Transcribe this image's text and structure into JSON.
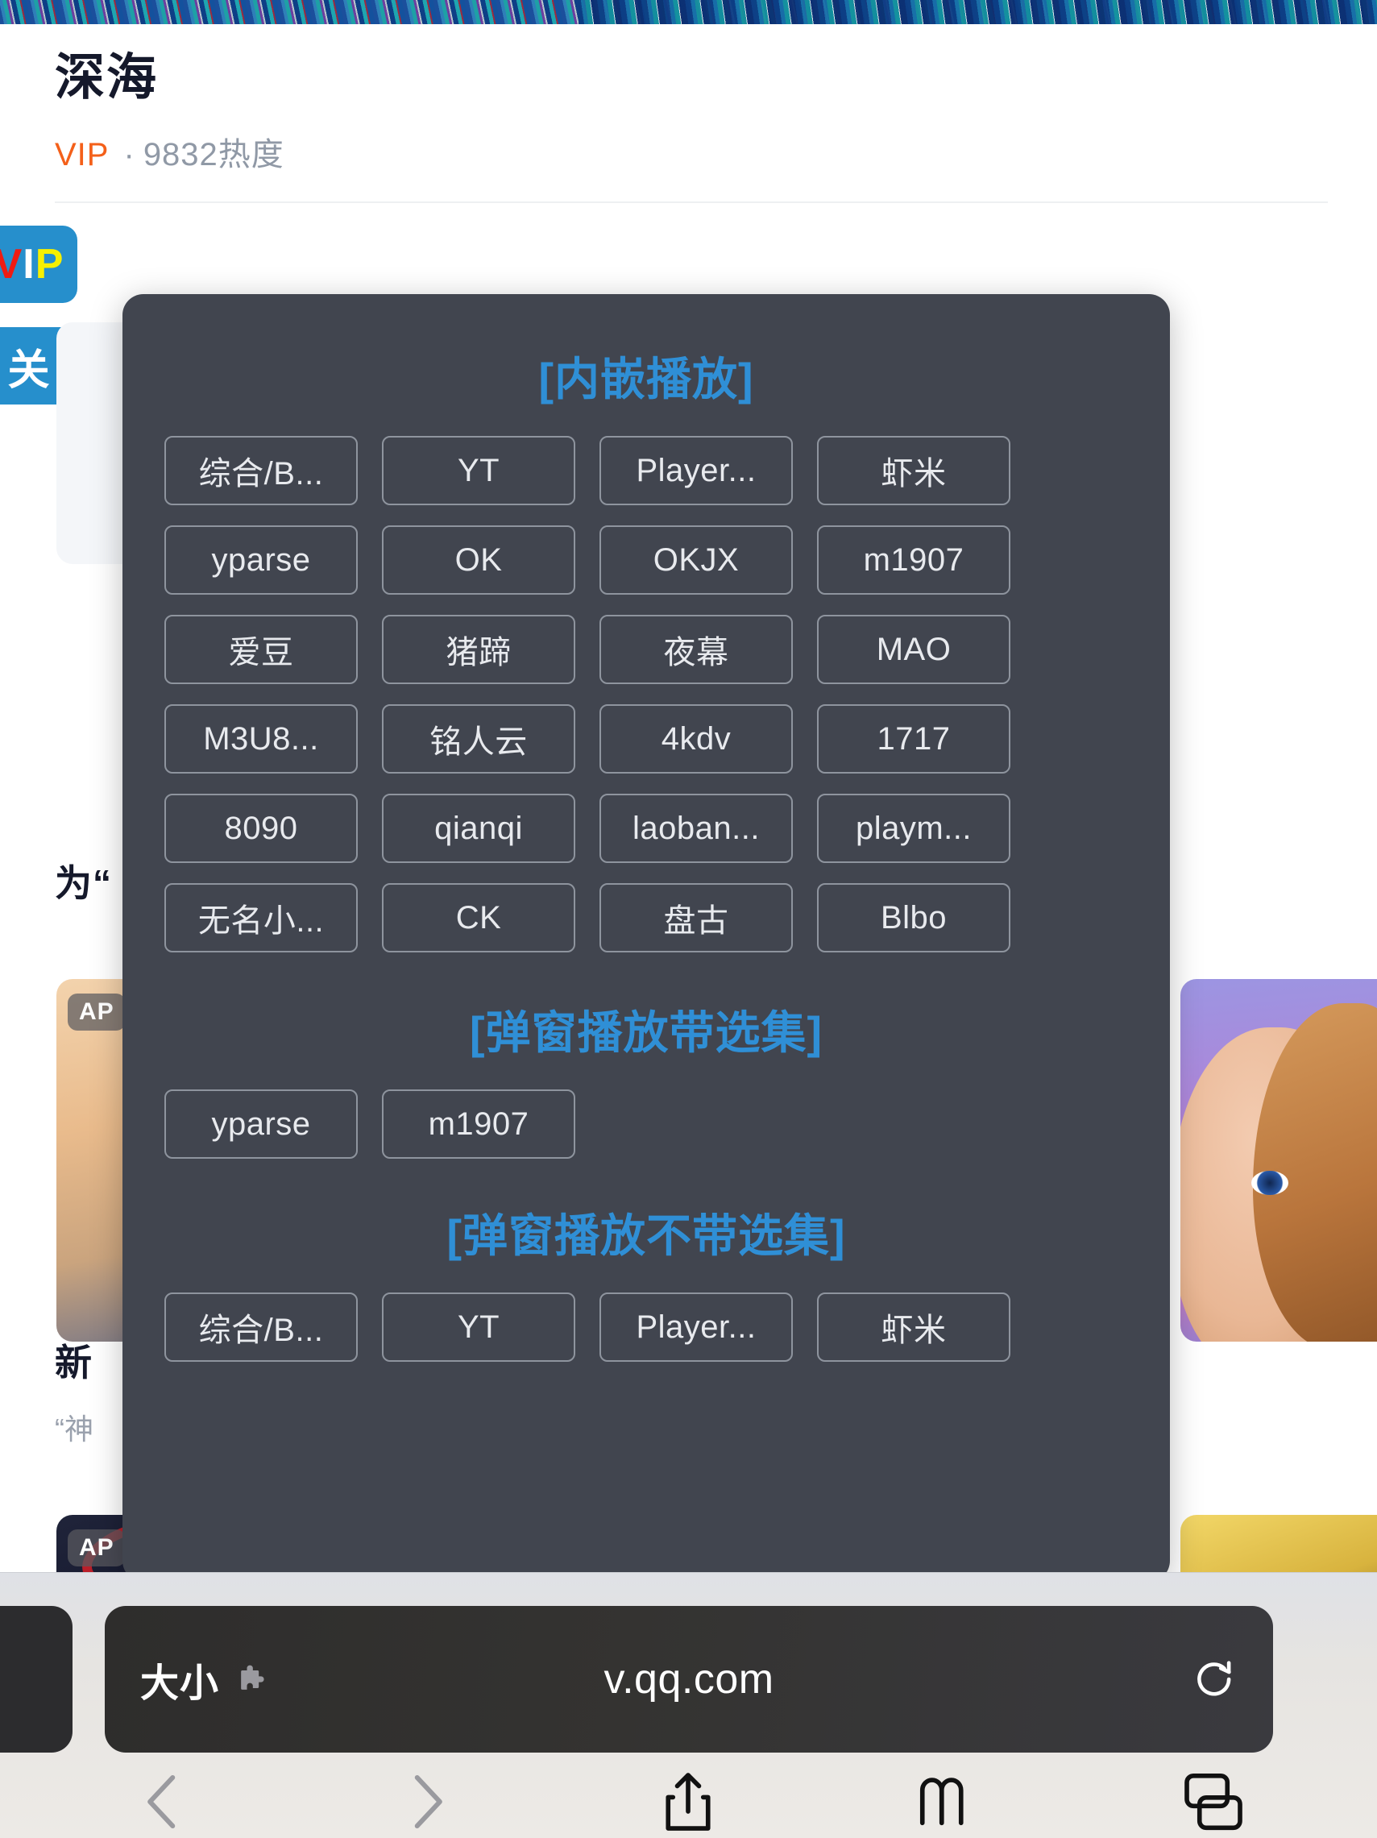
{
  "page": {
    "title": "深海",
    "meta": {
      "vip": "VIP",
      "separator": "·",
      "heat": "9832热度"
    },
    "badges": [
      {
        "name": "vip-badge",
        "letters": [
          "V",
          "I",
          "P"
        ]
      },
      {
        "name": "follow-badge",
        "text": "关"
      }
    ],
    "sections": [
      {
        "heading": "为“",
        "poster_badge": "AP"
      },
      {
        "heading": "新",
        "subtitle": "“神",
        "poster_badge": "AP"
      }
    ]
  },
  "modal": {
    "sections": [
      {
        "title": "[内嵌播放]",
        "columns": 4,
        "buttons": [
          "综合/B...",
          "YT",
          "Player...",
          "虾米",
          "yparse",
          "OK",
          "OKJX",
          "m1907",
          "爱豆",
          "猪蹄",
          "夜幕",
          "MAO",
          "M3U8...",
          "铭人云",
          "4kdv",
          "1717",
          "8090",
          "qianqi",
          "laoban...",
          "playm...",
          "无名小...",
          "CK",
          "盘古",
          "Blbo"
        ]
      },
      {
        "title": "[弹窗播放带选集]",
        "columns": 2,
        "buttons": [
          "yparse",
          "m1907"
        ]
      },
      {
        "title": "[弹窗播放不带选集]",
        "columns": 4,
        "buttons": [
          "综合/B...",
          "YT",
          "Player...",
          "虾米"
        ]
      }
    ]
  },
  "browser": {
    "url": "v.qq.com",
    "text_size_label": "大小",
    "icons": {
      "extension": "puzzle-icon",
      "reload": "reload-icon",
      "back": "back-chevron-icon",
      "forward": "forward-chevron-icon",
      "share": "share-icon",
      "bookmarks": "book-icon",
      "tabs": "tabs-icon"
    }
  },
  "colors": {
    "modal_bg": "#41454f",
    "modal_title": "#2f8fd6",
    "button_border": "#8e949e",
    "button_text": "#e8eaee",
    "vip_orange": "#f4601a",
    "badge_blue": "#268fcc",
    "chrome_dark": "#2c2c2e"
  }
}
